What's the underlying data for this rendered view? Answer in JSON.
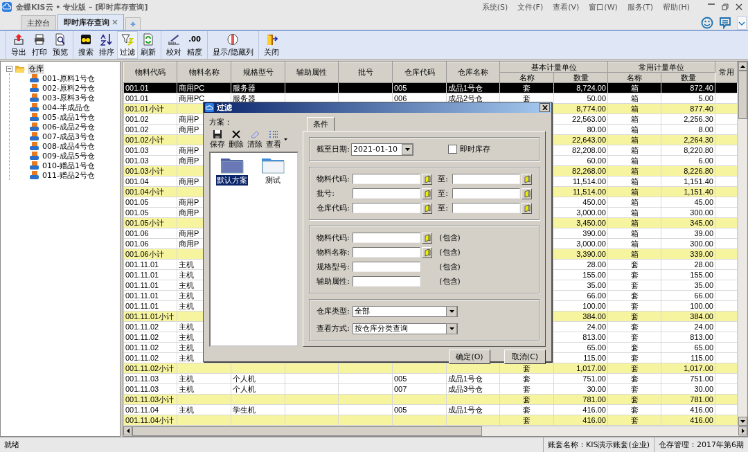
{
  "window": {
    "title": "金蝶KIS云 • 专业版 – [即时库存查询]",
    "menu": [
      "系统(S)",
      "文件(F)",
      "查看(V)",
      "窗口(W)",
      "服务(T)",
      "帮助(H)"
    ]
  },
  "tabs": [
    {
      "label": "主控台",
      "selected": false,
      "closable": false
    },
    {
      "label": "即时库存查询",
      "selected": true,
      "closable": true
    }
  ],
  "toolbar": [
    {
      "label": "导出",
      "pressed": false
    },
    {
      "label": "打印",
      "pressed": false
    },
    {
      "label": "预览",
      "pressed": false
    },
    {
      "label": "搜索",
      "pressed": false
    },
    {
      "label": "排序",
      "pressed": false
    },
    {
      "label": "过滤",
      "pressed": true
    },
    {
      "label": "刷新",
      "pressed": false
    },
    {
      "label": "校对",
      "pressed": false
    },
    {
      "label": "精度",
      "glyph": ".00",
      "pressed": false
    },
    {
      "label": "显示/隐藏列",
      "pressed": false
    },
    {
      "label": "关闭",
      "pressed": false
    }
  ],
  "tree": {
    "label": "仓库",
    "selected": true,
    "expanded": true,
    "children": [
      {
        "label": "001-原料1号仓",
        "selected": false
      },
      {
        "label": "002-原料2号仓",
        "selected": false
      },
      {
        "label": "003-原料3号仓",
        "selected": false
      },
      {
        "label": "004-半成品仓",
        "selected": false
      },
      {
        "label": "005-成品1号仓",
        "selected": false
      },
      {
        "label": "006-成品2号仓",
        "selected": false
      },
      {
        "label": "007-成品3号仓",
        "selected": false
      },
      {
        "label": "008-成品4号仓",
        "selected": false
      },
      {
        "label": "009-成品5号仓",
        "selected": false
      },
      {
        "label": "010-赠品1号仓",
        "selected": false
      },
      {
        "label": "011-赠品2号仓",
        "selected": false
      }
    ]
  },
  "table": {
    "columns": [
      {
        "label": "物料代码",
        "kind": "text"
      },
      {
        "label": "物料名称",
        "kind": "text"
      },
      {
        "label": "规格型号",
        "kind": "text"
      },
      {
        "label": "辅助属性",
        "kind": "text"
      },
      {
        "label": "批号",
        "kind": "text"
      },
      {
        "label": "仓库代码",
        "kind": "text"
      },
      {
        "label": "仓库名称",
        "kind": "text"
      },
      {
        "label": "名称",
        "kind": "unit"
      },
      {
        "label": "数量",
        "kind": "number"
      },
      {
        "label": "名称",
        "kind": "unit"
      },
      {
        "label": "数量",
        "kind": "number"
      },
      {
        "label": "常用",
        "kind": "text"
      }
    ],
    "column_groups": [
      {
        "label": "基本计量单位"
      },
      {
        "label": "常用计量单位"
      }
    ],
    "rows": [
      {
        "kind": "item",
        "selected": true,
        "cells": [
          "001.01",
          "商用PC",
          "服务器",
          null,
          null,
          "005",
          "成品1号仓",
          "套",
          "8,724.00",
          "箱",
          "872.40"
        ]
      },
      {
        "kind": "item",
        "selected": false,
        "cells": [
          "001.01",
          "商用PC",
          "服务器",
          null,
          null,
          "006",
          "成品2号仓",
          "套",
          "50.00",
          "箱",
          "5.00"
        ]
      },
      {
        "kind": "subtotal",
        "selected": false,
        "cells": [
          "001.01小计",
          null,
          null,
          null,
          null,
          null,
          null,
          null,
          "8,774.00",
          "箱",
          "877.40"
        ]
      },
      {
        "kind": "item",
        "selected": false,
        "cells": [
          "001.02",
          "商用P",
          null,
          null,
          null,
          null,
          null,
          null,
          "22,563.00",
          "箱",
          "2,256.30"
        ]
      },
      {
        "kind": "item",
        "selected": false,
        "cells": [
          "001.02",
          "商用P",
          null,
          null,
          null,
          null,
          null,
          null,
          "80.00",
          "箱",
          "8.00"
        ]
      },
      {
        "kind": "subtotal",
        "selected": false,
        "cells": [
          "001.02小计",
          null,
          null,
          null,
          null,
          null,
          null,
          null,
          "22,643.00",
          "箱",
          "2,264.30"
        ]
      },
      {
        "kind": "item",
        "selected": false,
        "cells": [
          "001.03",
          "商用P",
          null,
          null,
          null,
          null,
          null,
          null,
          "82,208.00",
          "箱",
          "8,220.80"
        ]
      },
      {
        "kind": "item",
        "selected": false,
        "cells": [
          "001.03",
          "商用P",
          null,
          null,
          null,
          null,
          null,
          null,
          "60.00",
          "箱",
          "6.00"
        ]
      },
      {
        "kind": "subtotal",
        "selected": false,
        "cells": [
          "001.03小计",
          null,
          null,
          null,
          null,
          null,
          null,
          null,
          "82,268.00",
          "箱",
          "8,226.80"
        ]
      },
      {
        "kind": "item",
        "selected": false,
        "cells": [
          "001.04",
          "商用P",
          null,
          null,
          null,
          null,
          null,
          null,
          "11,514.00",
          "箱",
          "1,151.40"
        ]
      },
      {
        "kind": "subtotal",
        "selected": false,
        "cells": [
          "001.04小计",
          null,
          null,
          null,
          null,
          null,
          null,
          null,
          "11,514.00",
          "箱",
          "1,151.40"
        ]
      },
      {
        "kind": "item",
        "selected": false,
        "cells": [
          "001.05",
          "商用P",
          null,
          null,
          null,
          null,
          null,
          null,
          "450.00",
          "箱",
          "45.00"
        ]
      },
      {
        "kind": "item",
        "selected": false,
        "cells": [
          "001.05",
          "商用P",
          null,
          null,
          null,
          null,
          null,
          null,
          "3,000.00",
          "箱",
          "300.00"
        ]
      },
      {
        "kind": "subtotal",
        "selected": false,
        "cells": [
          "001.05小计",
          null,
          null,
          null,
          null,
          null,
          null,
          null,
          "3,450.00",
          "箱",
          "345.00"
        ]
      },
      {
        "kind": "item",
        "selected": false,
        "cells": [
          "001.06",
          "商用P",
          null,
          null,
          null,
          null,
          null,
          null,
          "390.00",
          "箱",
          "39.00"
        ]
      },
      {
        "kind": "item",
        "selected": false,
        "cells": [
          "001.06",
          "商用P",
          null,
          null,
          null,
          null,
          null,
          null,
          "3,000.00",
          "箱",
          "300.00"
        ]
      },
      {
        "kind": "subtotal",
        "selected": false,
        "cells": [
          "001.06小计",
          null,
          null,
          null,
          null,
          null,
          null,
          null,
          "3,390.00",
          "箱",
          "339.00"
        ]
      },
      {
        "kind": "item",
        "selected": false,
        "cells": [
          "001.11.01",
          "主机",
          null,
          null,
          null,
          null,
          null,
          null,
          "28.00",
          "套",
          "28.00"
        ]
      },
      {
        "kind": "item",
        "selected": false,
        "cells": [
          "001.11.01",
          "主机",
          null,
          null,
          null,
          null,
          null,
          null,
          "155.00",
          "套",
          "155.00"
        ]
      },
      {
        "kind": "item",
        "selected": false,
        "cells": [
          "001.11.01",
          "主机",
          null,
          null,
          null,
          null,
          null,
          null,
          "35.00",
          "套",
          "35.00"
        ]
      },
      {
        "kind": "item",
        "selected": false,
        "cells": [
          "001.11.01",
          "主机",
          null,
          null,
          null,
          null,
          null,
          null,
          "66.00",
          "套",
          "66.00"
        ]
      },
      {
        "kind": "item",
        "selected": false,
        "cells": [
          "001.11.01",
          "主机",
          null,
          null,
          null,
          null,
          null,
          null,
          "100.00",
          "套",
          "100.00"
        ]
      },
      {
        "kind": "subtotal",
        "selected": false,
        "cells": [
          "001.11.01小计",
          null,
          null,
          null,
          null,
          null,
          null,
          null,
          "384.00",
          "套",
          "384.00"
        ]
      },
      {
        "kind": "item",
        "selected": false,
        "cells": [
          "001.11.02",
          "主机",
          null,
          null,
          null,
          null,
          null,
          null,
          "24.00",
          "套",
          "24.00"
        ]
      },
      {
        "kind": "item",
        "selected": false,
        "cells": [
          "001.11.02",
          "主机",
          null,
          null,
          null,
          null,
          null,
          null,
          "813.00",
          "套",
          "813.00"
        ]
      },
      {
        "kind": "item",
        "selected": false,
        "cells": [
          "001.11.02",
          "主机",
          null,
          null,
          null,
          null,
          null,
          null,
          "65.00",
          "套",
          "65.00"
        ]
      },
      {
        "kind": "item",
        "selected": false,
        "cells": [
          "001.11.02",
          "主机",
          null,
          null,
          null,
          null,
          null,
          null,
          "115.00",
          "套",
          "115.00"
        ]
      },
      {
        "kind": "subtotal",
        "selected": false,
        "cells": [
          "001.11.02小计",
          null,
          null,
          null,
          null,
          null,
          null,
          "套",
          "1,017.00",
          "套",
          "1,017.00"
        ]
      },
      {
        "kind": "item",
        "selected": false,
        "cells": [
          "001.11.03",
          "主机",
          "个人机",
          null,
          null,
          "005",
          "成品1号仓",
          "套",
          "751.00",
          "套",
          "751.00"
        ]
      },
      {
        "kind": "item",
        "selected": false,
        "cells": [
          "001.11.03",
          "主机",
          "个人机",
          null,
          null,
          "007",
          "成品3号仓",
          "套",
          "30.00",
          "套",
          "30.00"
        ]
      },
      {
        "kind": "subtotal",
        "selected": false,
        "cells": [
          "001.11.03小计",
          null,
          null,
          null,
          null,
          null,
          null,
          "套",
          "781.00",
          "套",
          "781.00"
        ]
      },
      {
        "kind": "item",
        "selected": false,
        "cells": [
          "001.11.04",
          "主机",
          "学生机",
          null,
          null,
          "005",
          "成品1号仓",
          "套",
          "416.00",
          "套",
          "416.00"
        ]
      },
      {
        "kind": "subtotal",
        "selected": false,
        "cells": [
          "001.11.04小计",
          null,
          null,
          null,
          null,
          null,
          null,
          "套",
          "416.00",
          "套",
          "416.00"
        ]
      }
    ]
  },
  "dialog": {
    "title": "过滤",
    "scheme_label": "方案：",
    "scheme_tools": [
      "保存",
      "删除",
      "清除",
      "查看"
    ],
    "schemes": [
      {
        "label": "默认方案",
        "selected": true
      },
      {
        "label": "测试",
        "selected": false
      }
    ],
    "tab": "条件",
    "date": {
      "label": "截至日期:",
      "value": "2021-01-10"
    },
    "checkbox": {
      "label": "即时库存",
      "checked": false
    },
    "ranges": [
      {
        "label": "物料代码:",
        "to": "至:"
      },
      {
        "label": "批号:",
        "to": "至:"
      },
      {
        "label": "仓库代码:",
        "to": "至:"
      }
    ],
    "contains": [
      {
        "label": "物料代码:",
        "lookup": true,
        "note": "(包含)"
      },
      {
        "label": "物料名称:",
        "lookup": true,
        "note": "(包含)"
      },
      {
        "label": "规格型号:",
        "lookup": false,
        "note": "(包含)"
      },
      {
        "label": "辅助属性:",
        "lookup": false,
        "note": "(包含)"
      }
    ],
    "selects": [
      {
        "label": "仓库类型:",
        "value": "全部"
      },
      {
        "label": "查看方式:",
        "value": "按仓库分类查询"
      }
    ],
    "buttons": [
      "确定(O)",
      "取消(C)"
    ]
  },
  "status_bar": [
    "就绪",
    "账套名称：KIS演示账套(企业)",
    "仓存管理：2017年第6期"
  ]
}
